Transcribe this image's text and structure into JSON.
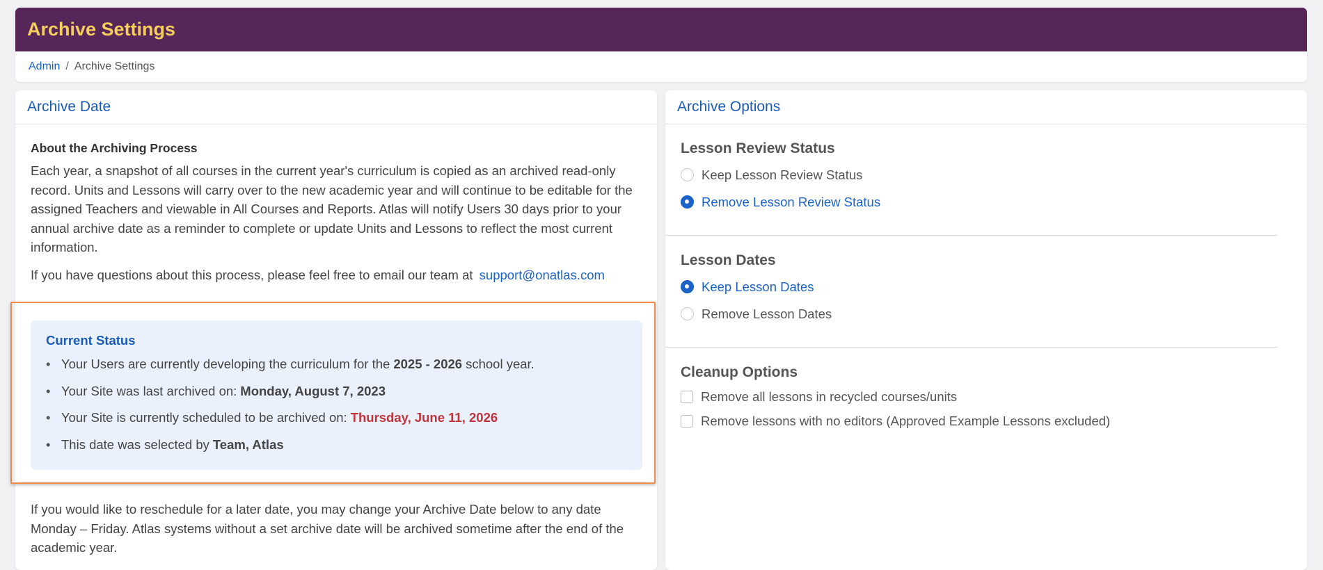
{
  "header": {
    "title": "Archive Settings",
    "breadcrumb": {
      "root": "Admin",
      "separator": "/",
      "current": "Archive Settings"
    }
  },
  "archive_date": {
    "panel_title": "Archive Date",
    "about_heading": "About the Archiving Process",
    "about_text": "Each year, a snapshot of all courses in the current year's curriculum is copied as an archived read-only record. Units and Lessons will carry over to the new academic year and will continue to be editable for the assigned Teachers and viewable in All Courses and Reports. Atlas will notify Users 30 days prior to your annual archive date as a reminder to complete or update Units and Lessons to reflect the most current information.",
    "contact_text": "If you have questions about this process, please feel free to email our team at",
    "contact_email": "support@onatlas.com",
    "status": {
      "title": "Current Status",
      "line1_prefix": "Your Users are currently developing the curriculum for the",
      "line1_year": "2025 - 2026",
      "line1_suffix": "school year.",
      "line2_prefix": "Your Site was last archived on:",
      "line2_date": "Monday, August 7, 2023",
      "line3_prefix": "Your Site is currently scheduled to be archived on:",
      "line3_date": "Thursday, June 11, 2026",
      "line4_prefix": "This date was selected by",
      "line4_user": "Team, Atlas"
    },
    "reschedule_text": "If you would like to reschedule for a later date, you may change your Archive Date below to any date Monday – Friday. Atlas systems without a set archive date will be archived sometime after the end of the academic year."
  },
  "archive_options": {
    "panel_title": "Archive Options",
    "lesson_review": {
      "heading": "Lesson Review Status",
      "keep_label": "Keep Lesson Review Status",
      "remove_label": "Remove Lesson Review Status",
      "selected": "remove"
    },
    "lesson_dates": {
      "heading": "Lesson Dates",
      "keep_label": "Keep Lesson Dates",
      "remove_label": "Remove Lesson Dates",
      "selected": "keep"
    },
    "cleanup": {
      "heading": "Cleanup Options",
      "option1_label": "Remove all lessons in recycled courses/units",
      "option2_label": "Remove lessons with no editors (Approved Example Lessons excluded)"
    }
  },
  "colors": {
    "header_bg": "#572658",
    "title_color": "#f5cf5e",
    "link_blue": "#1a62c6",
    "alert_red": "#c0343b",
    "highlight_orange": "#f08a4b"
  }
}
